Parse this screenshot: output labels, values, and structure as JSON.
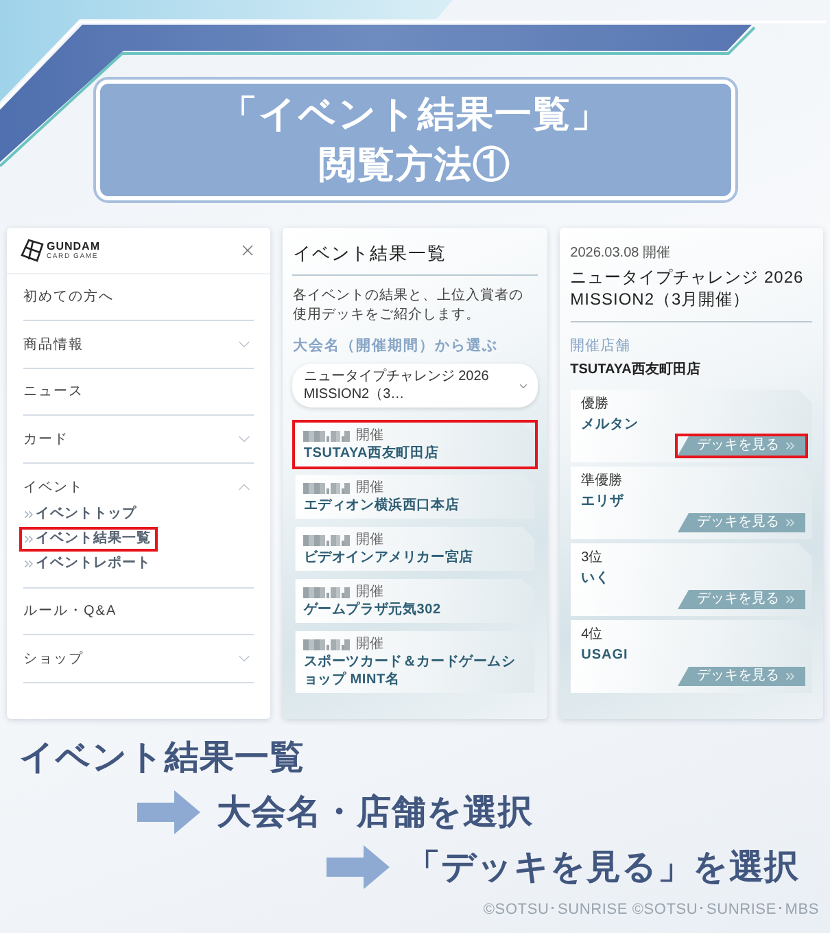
{
  "header": {
    "title_lines": [
      "「イベント結果一覧」",
      "閲覧方法①"
    ]
  },
  "menu_panel": {
    "logo": {
      "text": "GUNDAM",
      "subtext": "CARD GAME"
    },
    "items": [
      {
        "label": "初めての方へ",
        "kind": "link"
      },
      {
        "label": "商品情報",
        "kind": "group",
        "expanded": false
      },
      {
        "label": "ニュース",
        "kind": "link"
      },
      {
        "label": "カード",
        "kind": "group",
        "expanded": false
      },
      {
        "label": "イベント",
        "kind": "group",
        "expanded": true,
        "children": [
          {
            "label": "イベントトップ",
            "highlighted": false
          },
          {
            "label": "イベント結果一覧",
            "highlighted": true
          },
          {
            "label": "イベントレポート",
            "highlighted": false
          }
        ]
      },
      {
        "label": "ルール・Q&A",
        "kind": "link"
      },
      {
        "label": "ショップ",
        "kind": "group",
        "expanded": false
      }
    ]
  },
  "event_list_panel": {
    "title": "イベント結果一覧",
    "description": "各イベントの結果と、上位入賞者の使用デッキをご紹介します。",
    "filter_label": "大会名（開催期間）から選ぶ",
    "dropdown": {
      "value": "ニュータイプチャレンジ 2026 MISSION2（3…"
    },
    "events": [
      {
        "status": "開催",
        "store": "TSUTAYA西友町田店",
        "highlighted": true
      },
      {
        "status": "開催",
        "store": "エディオン横浜西口本店",
        "highlighted": false
      },
      {
        "status": "開催",
        "store": "ビデオインアメリカー宮店",
        "highlighted": false
      },
      {
        "status": "開催",
        "store": "ゲームプラザ元気302",
        "highlighted": false
      },
      {
        "status": "開催",
        "store": "スポーツカード＆カードゲームショップ MINT名",
        "highlighted": false
      }
    ]
  },
  "event_detail_panel": {
    "date": "2026.03.08 開催",
    "title": "ニュータイプチャレンジ 2026 MISSION2（3月開催）",
    "store_label": "開催店舗",
    "store": "TSUTAYA西友町田店",
    "results": [
      {
        "rank": "優勝",
        "player": "メルタン",
        "button": "デッキを見る",
        "highlighted": true
      },
      {
        "rank": "準優勝",
        "player": "エリザ",
        "button": "デッキを見る",
        "highlighted": false
      },
      {
        "rank": "3位",
        "player": "いく",
        "button": "デッキを見る",
        "highlighted": false
      },
      {
        "rank": "4位",
        "player": "USAGI",
        "button": "デッキを見る",
        "highlighted": false
      }
    ]
  },
  "steps": [
    "イベント結果一覧",
    "大会名・店舗を選択",
    "「デッキを見る」を選択"
  ],
  "copyright": "©SOTSU･SUNRISE ©SOTSU･SUNRISE･MBS"
}
